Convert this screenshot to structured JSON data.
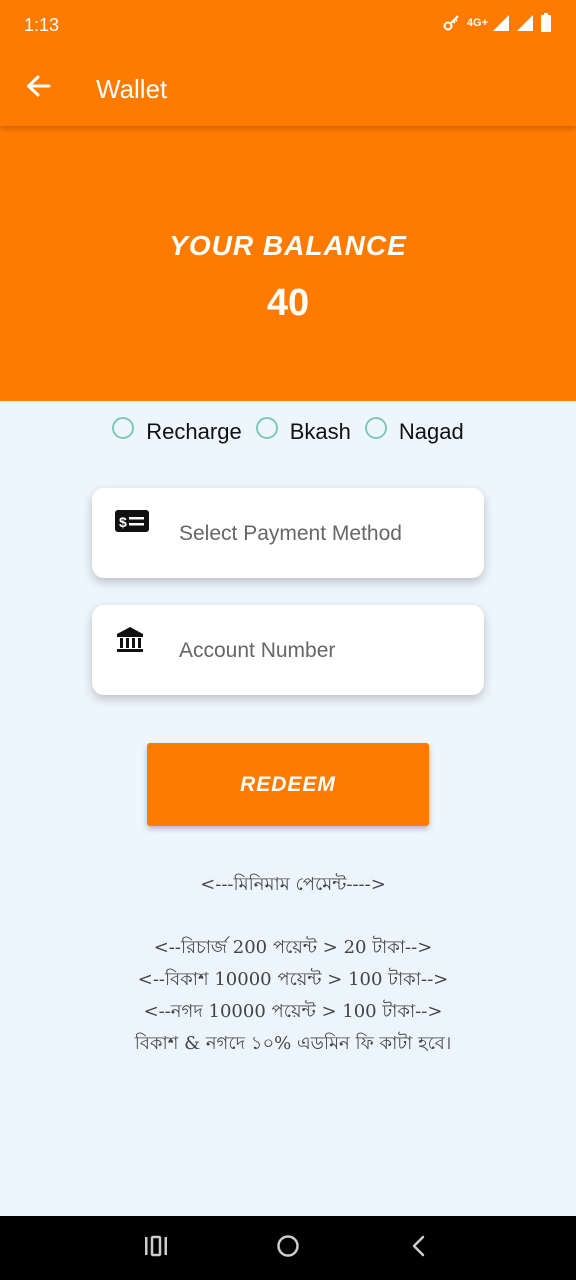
{
  "status_bar": {
    "time": "1:13",
    "network": "4G+",
    "icons": [
      "vpn-key-icon",
      "signal-icon",
      "signal-icon",
      "battery-icon"
    ]
  },
  "app_bar": {
    "title": "Wallet",
    "back_icon": "arrow-left-icon"
  },
  "balance": {
    "label": "YOUR BALANCE",
    "value": "40"
  },
  "payment_options": [
    {
      "label": "Recharge",
      "selected": false
    },
    {
      "label": "Bkash",
      "selected": false
    },
    {
      "label": "Nagad",
      "selected": false
    }
  ],
  "payment_method_field": {
    "placeholder": "Select Payment Method",
    "icon": "money-card-icon"
  },
  "account_number_field": {
    "placeholder": "Account Number",
    "icon": "bank-icon"
  },
  "redeem_button": {
    "label": "REDEEM"
  },
  "info": {
    "heading": "<---মিনিমাম পেমেন্ট---->",
    "lines": [
      "<--রিচার্জ 200 পয়েন্ট > 20 টাকা-->",
      "<--বিকাশ 10000 পয়েন্ট > 100 টাকা-->",
      "<--নগদ 10000 পয়েন্ট > 100 টাকা-->",
      "বিকাশ & নগদে ১০% এডমিন ফি কাটা হবে।"
    ]
  },
  "colors": {
    "primary": "#ff7b00",
    "background": "#eef6fd",
    "radio": "#7fc8c0"
  }
}
